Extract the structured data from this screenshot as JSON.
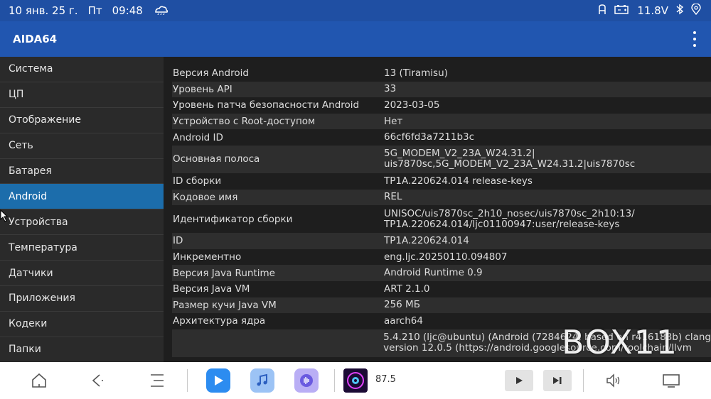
{
  "status_bar": {
    "date": "10 янв. 25 г.",
    "weekday": "Пт",
    "time": "09:48",
    "voltage": "11.8V",
    "icons": [
      "weather-icon",
      "seat-icon",
      "battery-icon",
      "bluetooth-icon",
      "location-icon"
    ]
  },
  "appbar": {
    "title": "AIDA64"
  },
  "sidebar": {
    "items": [
      {
        "label": "Система"
      },
      {
        "label": "ЦП"
      },
      {
        "label": "Отображение"
      },
      {
        "label": "Сеть"
      },
      {
        "label": "Батарея"
      },
      {
        "label": "Android"
      },
      {
        "label": "Устройства"
      },
      {
        "label": "Температура"
      },
      {
        "label": "Датчики"
      },
      {
        "label": "Приложения"
      },
      {
        "label": "Кодеки"
      },
      {
        "label": "Папки"
      }
    ],
    "active": "Android"
  },
  "details": {
    "rows": [
      {
        "key": "Версия Android",
        "value": "13 (Tiramisu)",
        "value2": ""
      },
      {
        "key": "Уровень API",
        "value": "33",
        "value2": ""
      },
      {
        "key": "Уровень патча безопасности Android",
        "value": "2023-03-05",
        "value2": ""
      },
      {
        "key": "Устройство с Root-доступом",
        "value": "Нет",
        "value2": ""
      },
      {
        "key": "Android ID",
        "value": "66cf6fd3a7211b3c",
        "value2": ""
      },
      {
        "key": "Основная полоса",
        "value": "5G_MODEM_V2_23A_W24.31.2|",
        "value2": "uis7870sc,5G_MODEM_V2_23A_W24.31.2|uis7870sc"
      },
      {
        "key": "ID сборки",
        "value": "TP1A.220624.014 release-keys",
        "value2": ""
      },
      {
        "key": "Кодовое имя",
        "value": "REL",
        "value2": ""
      },
      {
        "key": "Идентификатор сборки",
        "value": "UNISOC/uis7870sc_2h10_nosec/uis7870sc_2h10:13/",
        "value2": "TP1A.220624.014/ljc01100947:user/release-keys"
      },
      {
        "key": "ID",
        "value": "TP1A.220624.014",
        "value2": ""
      },
      {
        "key": "Инкрементно",
        "value": "eng.ljc.20250110.094807",
        "value2": ""
      },
      {
        "key": "Версия Java Runtime",
        "value": "Android Runtime 0.9",
        "value2": ""
      },
      {
        "key": "Версия Java VM",
        "value": "ART 2.1.0",
        "value2": ""
      },
      {
        "key": "Размер кучи Java VM",
        "value": "256 МБ",
        "value2": ""
      },
      {
        "key": "Архитектура ядра",
        "value": "aarch64",
        "value2": ""
      },
      {
        "key": "",
        "value": "5.4.210 (ljc@ubuntu) (Android (7284624, based on r416183b) clang",
        "value2": "version 12.0.5 (https://android.googlesource.com/toolchain/llvm"
      }
    ]
  },
  "navbar": {
    "radio_frequency": "87.5",
    "icons": [
      "home-icon",
      "back-icon",
      "menu-icon",
      "video-player-icon",
      "music-icon",
      "voice-icon",
      "radio-album-art",
      "play-icon",
      "next-icon",
      "volume-icon",
      "screen-icon"
    ]
  },
  "watermark": "BOX11",
  "colors": {
    "status_bar": "#1f4fa3",
    "appbar": "#2156b0",
    "active_item": "#1c6dab",
    "background": "#1e1e1e"
  }
}
